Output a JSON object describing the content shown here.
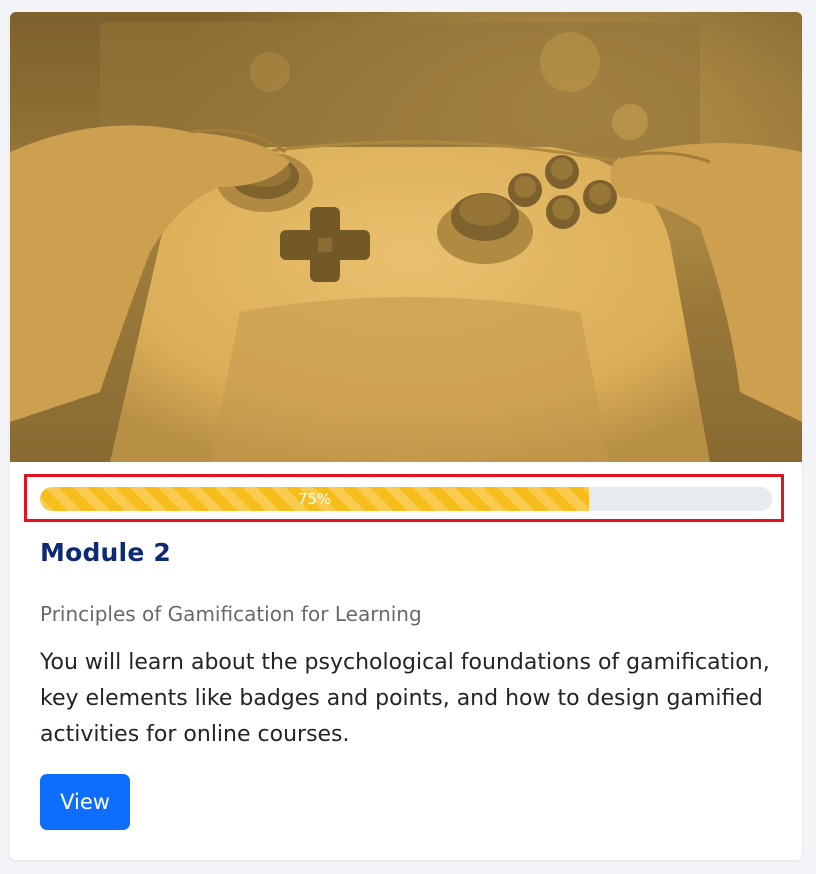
{
  "colors": {
    "accent": "#0d6efd",
    "progress_fill": "#f7bd1c",
    "progress_track": "#e7eaee",
    "highlight_border": "#e0141e",
    "title": "#0d2a72",
    "hero_tint": "#e2b256"
  },
  "hero": {
    "icon": "game-controller-image"
  },
  "progress": {
    "value": 0.75,
    "label": "75%"
  },
  "module": {
    "title": "Module 2",
    "subtitle": "Principles of Gamification for Learning",
    "description": "You will learn about the psychological foundations of gamification, key elements like badges and points, and how to design gamified activities for online courses.",
    "button_label": "View"
  }
}
